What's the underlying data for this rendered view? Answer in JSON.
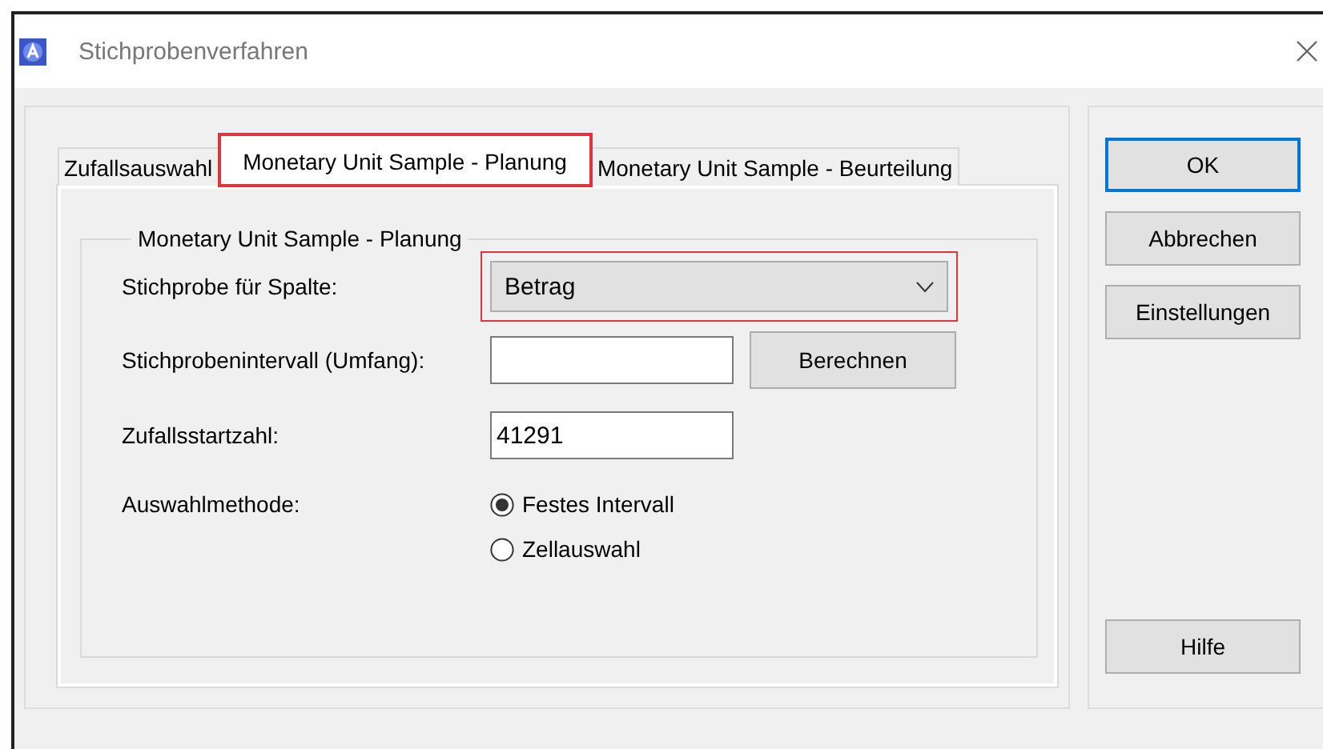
{
  "window": {
    "title": "Stichprobenverfahren"
  },
  "tabs": [
    {
      "label": "Zufallsauswahl",
      "selected": false,
      "highlighted": false
    },
    {
      "label": "Monetary Unit Sample - Planung",
      "selected": true,
      "highlighted": true
    },
    {
      "label": "Monetary Unit Sample - Beurteilung",
      "selected": false,
      "highlighted": false
    }
  ],
  "group": {
    "title": "Monetary Unit Sample - Planung",
    "column": {
      "label": "Stichprobe für Spalte:",
      "value": "Betrag",
      "highlighted": true
    },
    "interval": {
      "label": "Stichprobenintervall (Umfang):",
      "button": "Berechnen"
    },
    "seed": {
      "label": "Zufallsstartzahl:",
      "value": "41291"
    },
    "method": {
      "label": "Auswahlmethode:",
      "options": [
        {
          "label": "Festes Intervall",
          "selected": true
        },
        {
          "label": "Zellauswahl",
          "selected": false
        }
      ]
    }
  },
  "buttons": [
    {
      "label": "OK",
      "default": true
    },
    {
      "label": "Abbrechen",
      "default": false
    },
    {
      "label": "Einstellungen",
      "default": false
    },
    {
      "label": "Hilfe",
      "default": false
    }
  ]
}
